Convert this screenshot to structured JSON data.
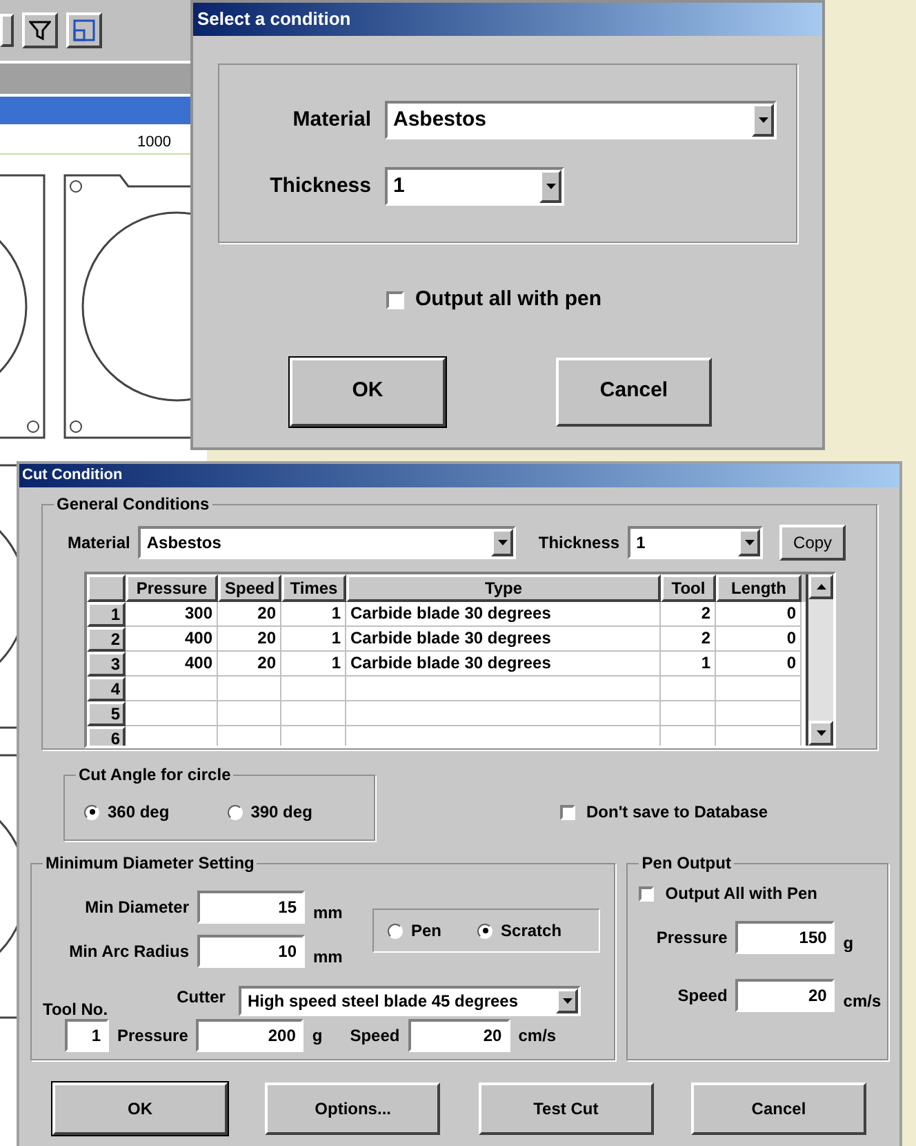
{
  "background_app": {
    "ruler_label": "1000"
  },
  "select_condition_dialog": {
    "title": "Select a condition",
    "material": {
      "label": "Material",
      "value": "Asbestos"
    },
    "thickness": {
      "label": "Thickness",
      "value": "1"
    },
    "output_all_with_pen": {
      "label": "Output all with pen",
      "checked": false
    },
    "buttons": [
      "OK",
      "Cancel"
    ]
  },
  "cut_condition_dialog": {
    "title": "Cut Condition",
    "general_conditions": {
      "title": "General Conditions",
      "material": {
        "label": "Material",
        "value": "Asbestos"
      },
      "thickness": {
        "label": "Thickness",
        "value": "1"
      },
      "copy_button": "Copy",
      "table": {
        "columns": [
          "Pressure",
          "Speed",
          "Times",
          "Type",
          "Tool",
          "Length"
        ],
        "rows": [
          {
            "number": "1",
            "cells": [
              "300",
              "20",
              "1",
              "Carbide blade 30 degrees",
              "2",
              "0"
            ]
          },
          {
            "number": "2",
            "cells": [
              "400",
              "20",
              "1",
              "Carbide blade 30 degrees",
              "2",
              "0"
            ]
          },
          {
            "number": "3",
            "cells": [
              "400",
              "20",
              "1",
              "Carbide blade 30 degrees",
              "1",
              "0"
            ]
          },
          {
            "number": "4",
            "cells": []
          },
          {
            "number": "5",
            "cells": []
          },
          {
            "number": "6",
            "cells": []
          }
        ]
      }
    },
    "cut_angle": {
      "title": "Cut Angle for circle",
      "options": [
        {
          "label": "360 deg",
          "selected": true
        },
        {
          "label": "390 deg",
          "selected": false
        }
      ]
    },
    "dont_save": {
      "label": "Don't save to Database",
      "checked": false
    },
    "minimum_diameter": {
      "title": "Minimum Diameter Setting",
      "min_diameter": {
        "label": "Min Diameter",
        "value": "15",
        "unit": "mm"
      },
      "min_arc_radius": {
        "label": "Min Arc Radius",
        "value": "10",
        "unit": "mm"
      },
      "mode": [
        {
          "label": "Pen",
          "selected": false
        },
        {
          "label": "Scratch",
          "selected": true
        }
      ],
      "tool_no": {
        "label": "Tool No.",
        "value": "1"
      },
      "cutter": {
        "label": "Cutter",
        "value": "High speed steel blade 45 degrees"
      },
      "pressure": {
        "label": "Pressure",
        "value": "200",
        "unit": "g"
      },
      "speed": {
        "label": "Speed",
        "value": "20",
        "unit": "cm/s"
      }
    },
    "pen_output": {
      "title": "Pen Output",
      "output_all": {
        "label": "Output All with Pen",
        "checked": false
      },
      "pressure": {
        "label": "Pressure",
        "value": "150",
        "unit": "g"
      },
      "speed": {
        "label": "Speed",
        "value": "20",
        "unit": "cm/s"
      }
    },
    "buttons": [
      "OK",
      "Options...",
      "Test Cut",
      "Cancel"
    ]
  }
}
